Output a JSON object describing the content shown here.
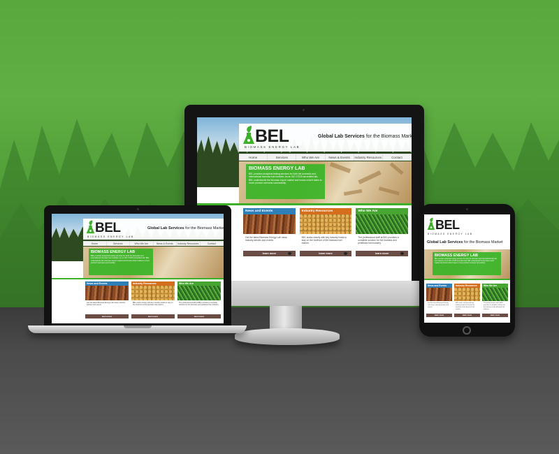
{
  "site": {
    "logo_text": "BEL",
    "logo_sub": "BIOMASS ENERGY LAB",
    "tagline_bold": "Global Lab Services",
    "tagline_rest": " for the Biomass Market",
    "nav": [
      "Home",
      "Services",
      "Who We Are",
      "News & Events",
      "Industry Resources",
      "Contact"
    ],
    "promo_title": "BIOMASS ENERGY LAB",
    "promo_text": "BEL provides analytical testing services for both the domestic and international biomass fuel markets. As an ISO 17025 accredited lab, BEL understands the biomass export market and knows what it takes to move product overseas successfully.",
    "cards": [
      {
        "title": "News and Events",
        "text": "Get the latest Biomass Energy Lab news, industry articles and events.",
        "button": "learn more"
      },
      {
        "title": "Industry Resources",
        "text": "BEL works closely with key industry leads to stay on the forefront of the biomass fuel market.",
        "button": "learn more"
      },
      {
        "title": "Who We Are",
        "text": "The professional staff at BEL provides a complete solution for the biomass and pelletized fuel industry.",
        "button": "learn more"
      }
    ]
  },
  "colors": {
    "background_green": "#5fb043",
    "brand_green": "#3db02a",
    "card_blue": "#2f7fb8",
    "card_orange": "#d46e1c",
    "card_green": "#47a532",
    "button_brown": "#6b4d46"
  },
  "icons": [
    "flask-leaf-icon",
    "arrow-icon"
  ]
}
